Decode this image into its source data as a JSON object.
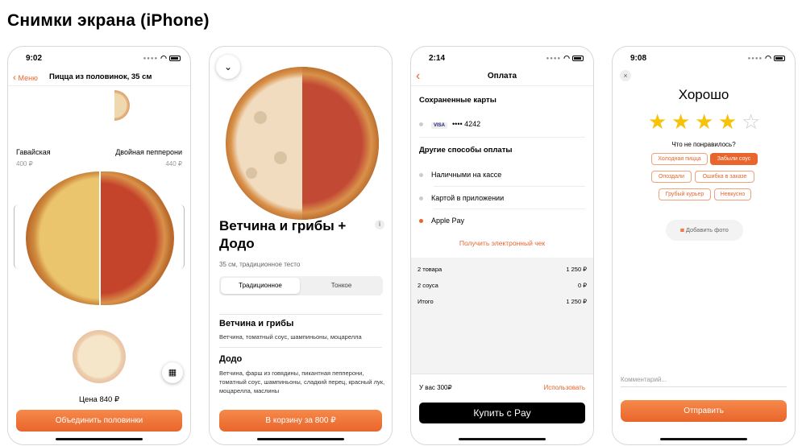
{
  "page_title": "Снимки экрана (iPhone)",
  "screens": [
    {
      "time": "9:02",
      "back_label": "Меню",
      "title": "Пицца из половинок, 35 см",
      "left_name": "Гавайская",
      "left_price": "400 ₽",
      "right_name": "Двойная пепперони",
      "right_price": "440 ₽",
      "price_label": "Цена 840 ₽",
      "button": "Объединить половинки"
    },
    {
      "pizza_name": "Ветчина и грибы + Додо",
      "size_info": "35 см, традиционное тесто",
      "seg_traditional": "Традиционное",
      "seg_thin": "Тонкое",
      "half1_title": "Ветчина и грибы",
      "half1_desc": "Ветчина, томатный соус, шампиньоны, моцарелла",
      "half2_title": "Додо",
      "half2_desc": "Ветчина, фарш из говядины, пикантная пепперони, томатный соус, шампиньоны, сладкий перец, красный лук, моцарелла, маслины",
      "info_icon_label": "i",
      "button": "В корзину за 800 ₽"
    },
    {
      "time": "2:14",
      "title": "Оплата",
      "saved_cards": "Сохраненные карты",
      "card_brand": "VISA",
      "card_number": "•••• 4242",
      "other_methods": "Другие способы оплаты",
      "methods": [
        "Наличными на кассе",
        "Картой в приложении",
        "Apple Pay"
      ],
      "receipt_link": "Получить электронный чек",
      "summary": [
        {
          "label": "2 товара",
          "value": "1 250 ₽"
        },
        {
          "label": "2 соуса",
          "value": "0 ₽"
        },
        {
          "label": "Итого",
          "value": "1 250 ₽"
        }
      ],
      "bonus": "У вас 300₽",
      "use_label": "Использовать",
      "pay_button": "Купить с  Pay"
    },
    {
      "time": "9:08",
      "heading": "Хорошо",
      "rating": 4,
      "rating_max": 5,
      "question": "Что не понравилось?",
      "chips": [
        "Холодная пицца",
        "Забыли соус",
        "Опоздали",
        "Ошибка в заказе",
        "Грубый курьер",
        "Невкусно"
      ],
      "selected_chip": "Забыли соус",
      "add_photo": "Добавить фото",
      "comment_placeholder": "Комментарий...",
      "button": "Отправить"
    }
  ],
  "colors": {
    "accent": "#e9652c",
    "apple_pay_bg": "#000000"
  }
}
